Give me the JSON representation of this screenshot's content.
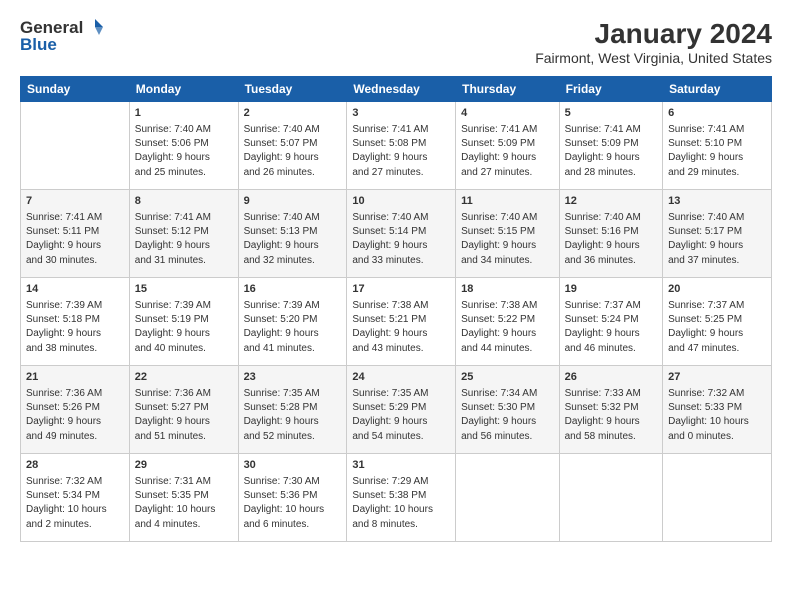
{
  "header": {
    "logo_line1": "General",
    "logo_line2": "Blue",
    "title": "January 2024",
    "subtitle": "Fairmont, West Virginia, United States"
  },
  "weekdays": [
    "Sunday",
    "Monday",
    "Tuesday",
    "Wednesday",
    "Thursday",
    "Friday",
    "Saturday"
  ],
  "weeks": [
    [
      {
        "num": "",
        "info": ""
      },
      {
        "num": "1",
        "info": "Sunrise: 7:40 AM\nSunset: 5:06 PM\nDaylight: 9 hours\nand 25 minutes."
      },
      {
        "num": "2",
        "info": "Sunrise: 7:40 AM\nSunset: 5:07 PM\nDaylight: 9 hours\nand 26 minutes."
      },
      {
        "num": "3",
        "info": "Sunrise: 7:41 AM\nSunset: 5:08 PM\nDaylight: 9 hours\nand 27 minutes."
      },
      {
        "num": "4",
        "info": "Sunrise: 7:41 AM\nSunset: 5:09 PM\nDaylight: 9 hours\nand 27 minutes."
      },
      {
        "num": "5",
        "info": "Sunrise: 7:41 AM\nSunset: 5:09 PM\nDaylight: 9 hours\nand 28 minutes."
      },
      {
        "num": "6",
        "info": "Sunrise: 7:41 AM\nSunset: 5:10 PM\nDaylight: 9 hours\nand 29 minutes."
      }
    ],
    [
      {
        "num": "7",
        "info": "Sunrise: 7:41 AM\nSunset: 5:11 PM\nDaylight: 9 hours\nand 30 minutes."
      },
      {
        "num": "8",
        "info": "Sunrise: 7:41 AM\nSunset: 5:12 PM\nDaylight: 9 hours\nand 31 minutes."
      },
      {
        "num": "9",
        "info": "Sunrise: 7:40 AM\nSunset: 5:13 PM\nDaylight: 9 hours\nand 32 minutes."
      },
      {
        "num": "10",
        "info": "Sunrise: 7:40 AM\nSunset: 5:14 PM\nDaylight: 9 hours\nand 33 minutes."
      },
      {
        "num": "11",
        "info": "Sunrise: 7:40 AM\nSunset: 5:15 PM\nDaylight: 9 hours\nand 34 minutes."
      },
      {
        "num": "12",
        "info": "Sunrise: 7:40 AM\nSunset: 5:16 PM\nDaylight: 9 hours\nand 36 minutes."
      },
      {
        "num": "13",
        "info": "Sunrise: 7:40 AM\nSunset: 5:17 PM\nDaylight: 9 hours\nand 37 minutes."
      }
    ],
    [
      {
        "num": "14",
        "info": "Sunrise: 7:39 AM\nSunset: 5:18 PM\nDaylight: 9 hours\nand 38 minutes."
      },
      {
        "num": "15",
        "info": "Sunrise: 7:39 AM\nSunset: 5:19 PM\nDaylight: 9 hours\nand 40 minutes."
      },
      {
        "num": "16",
        "info": "Sunrise: 7:39 AM\nSunset: 5:20 PM\nDaylight: 9 hours\nand 41 minutes."
      },
      {
        "num": "17",
        "info": "Sunrise: 7:38 AM\nSunset: 5:21 PM\nDaylight: 9 hours\nand 43 minutes."
      },
      {
        "num": "18",
        "info": "Sunrise: 7:38 AM\nSunset: 5:22 PM\nDaylight: 9 hours\nand 44 minutes."
      },
      {
        "num": "19",
        "info": "Sunrise: 7:37 AM\nSunset: 5:24 PM\nDaylight: 9 hours\nand 46 minutes."
      },
      {
        "num": "20",
        "info": "Sunrise: 7:37 AM\nSunset: 5:25 PM\nDaylight: 9 hours\nand 47 minutes."
      }
    ],
    [
      {
        "num": "21",
        "info": "Sunrise: 7:36 AM\nSunset: 5:26 PM\nDaylight: 9 hours\nand 49 minutes."
      },
      {
        "num": "22",
        "info": "Sunrise: 7:36 AM\nSunset: 5:27 PM\nDaylight: 9 hours\nand 51 minutes."
      },
      {
        "num": "23",
        "info": "Sunrise: 7:35 AM\nSunset: 5:28 PM\nDaylight: 9 hours\nand 52 minutes."
      },
      {
        "num": "24",
        "info": "Sunrise: 7:35 AM\nSunset: 5:29 PM\nDaylight: 9 hours\nand 54 minutes."
      },
      {
        "num": "25",
        "info": "Sunrise: 7:34 AM\nSunset: 5:30 PM\nDaylight: 9 hours\nand 56 minutes."
      },
      {
        "num": "26",
        "info": "Sunrise: 7:33 AM\nSunset: 5:32 PM\nDaylight: 9 hours\nand 58 minutes."
      },
      {
        "num": "27",
        "info": "Sunrise: 7:32 AM\nSunset: 5:33 PM\nDaylight: 10 hours\nand 0 minutes."
      }
    ],
    [
      {
        "num": "28",
        "info": "Sunrise: 7:32 AM\nSunset: 5:34 PM\nDaylight: 10 hours\nand 2 minutes."
      },
      {
        "num": "29",
        "info": "Sunrise: 7:31 AM\nSunset: 5:35 PM\nDaylight: 10 hours\nand 4 minutes."
      },
      {
        "num": "30",
        "info": "Sunrise: 7:30 AM\nSunset: 5:36 PM\nDaylight: 10 hours\nand 6 minutes."
      },
      {
        "num": "31",
        "info": "Sunrise: 7:29 AM\nSunset: 5:38 PM\nDaylight: 10 hours\nand 8 minutes."
      },
      {
        "num": "",
        "info": ""
      },
      {
        "num": "",
        "info": ""
      },
      {
        "num": "",
        "info": ""
      }
    ]
  ]
}
